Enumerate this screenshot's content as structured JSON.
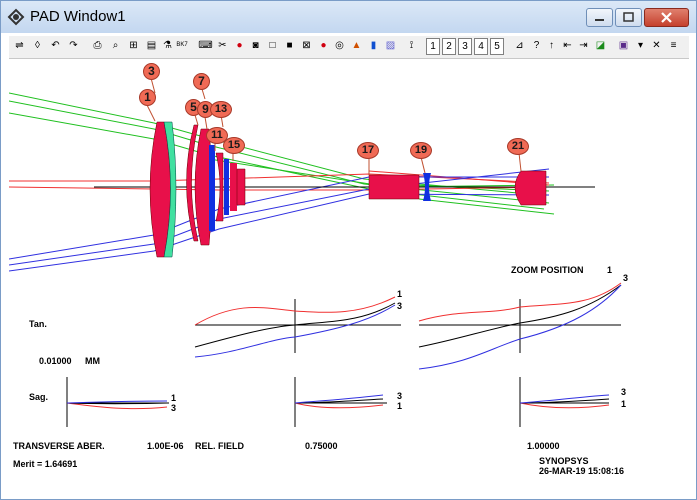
{
  "window": {
    "title": "PAD Window1"
  },
  "toolbar": {
    "zoom_buttons": [
      "1",
      "2",
      "3",
      "4",
      "5"
    ],
    "bk7_label": "BK7"
  },
  "surfaces": [
    "1",
    "3",
    "5",
    "7",
    "9",
    "11",
    "13",
    "15",
    "17",
    "19",
    "21"
  ],
  "zoom": {
    "label": "ZOOM POSITION",
    "value": "1"
  },
  "scale": {
    "value": "0.01000",
    "unit": "MM"
  },
  "curves": {
    "tan_label": "Tan.",
    "sag_label": "Sag.",
    "marker_1": "1",
    "marker_3": "3"
  },
  "footer": {
    "aber_label": "TRANSVERSE ABER.",
    "aber_value": "1.00E-06",
    "field_label": "REL. FIELD",
    "field_mid": "0.75000",
    "field_full": "1.00000",
    "merit": "Merit = 1.64691",
    "brand": "SYNOPSYS",
    "timestamp": "26-MAR-19  15:08:16"
  },
  "colors": {
    "lens_red": "#e8104a",
    "lens_green": "#40e0a0",
    "lens_blue": "#1030e0",
    "ray_green": "#20c020",
    "ray_red": "#f03030",
    "ray_blue": "#3030e0",
    "ray_black": "#000000"
  }
}
